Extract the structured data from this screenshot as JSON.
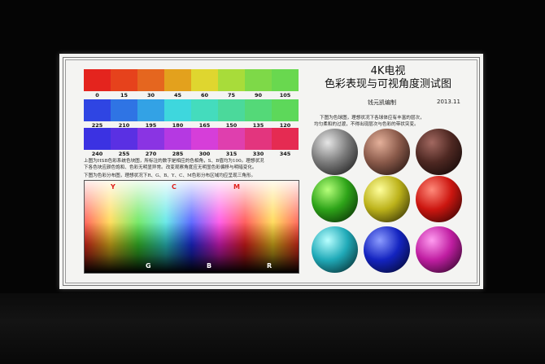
{
  "chart": {
    "title_line1": "4K电视",
    "title_line2": "色彩表现与可视角度测试图",
    "author": "钱元凯编制",
    "date": "2013.11"
  },
  "hue_rows": [
    {
      "hues": [
        "0",
        "15",
        "30",
        "45",
        "60",
        "75",
        "90",
        "105"
      ],
      "colors": [
        "#e4241e",
        "#e6421c",
        "#e5661f",
        "#e3a11d",
        "#dfd62f",
        "#a8dc3a",
        "#7ed948",
        "#69d84f"
      ]
    },
    {
      "hues": [
        "225",
        "210",
        "195",
        "180",
        "165",
        "150",
        "135",
        "120"
      ],
      "colors": [
        "#2f45e3",
        "#2f74e4",
        "#33a2e5",
        "#3ed7dd",
        "#44dcbd",
        "#4bd99b",
        "#54d978",
        "#5dd85a"
      ]
    },
    {
      "hues": [
        "240",
        "255",
        "270",
        "285",
        "300",
        "315",
        "330",
        "345"
      ],
      "colors": [
        "#3b32e2",
        "#5a30e3",
        "#8a34e3",
        "#b539e2",
        "#d63ed9",
        "#df3fae",
        "#e3357e",
        "#e52b52"
      ]
    }
  ],
  "texts": {
    "hue_note_line1": "上图为HSB色彩系统色块图，所标注的数字是相应的色相角，S、B值均为100。理想状况",
    "hue_note_line2": "下各色块应颜色饱和、色彩无明显异常。改变观察角度应无明显色彩偏移与明暗变化。",
    "dist_note": "下图为色彩分布图，理想状况下R、G、B、Y、C、M色彩分布区域均应呈现三角形。",
    "sphere_note_line1": "下图为色球图，理想状况下各球体应有丰富的层次，",
    "sphere_note_line2": "均匀柔和的过渡，不得出现层次与色彩的带状突变。"
  },
  "distribution_labels": {
    "top": [
      "Y",
      "C",
      "M"
    ],
    "bottom": [
      "G",
      "B",
      "R"
    ]
  },
  "spheres": [
    {
      "name": "gray",
      "light": "#e6e6e6",
      "mid": "#7c7c7c",
      "dark": "#0c0c0c"
    },
    {
      "name": "tan",
      "light": "#e4b09a",
      "mid": "#8a5a4a",
      "dark": "#120806"
    },
    {
      "name": "brown",
      "light": "#a26860",
      "mid": "#4e2822",
      "dark": "#070202"
    },
    {
      "name": "green",
      "light": "#b6ff7a",
      "mid": "#2ea419",
      "dark": "#031802"
    },
    {
      "name": "yellow",
      "light": "#ffff9c",
      "mid": "#bcb21a",
      "dark": "#1a1802"
    },
    {
      "name": "red",
      "light": "#ff8a7a",
      "mid": "#cc1610",
      "dark": "#1a0202"
    },
    {
      "name": "cyan",
      "light": "#b8ffff",
      "mid": "#20aab8",
      "dark": "#021618"
    },
    {
      "name": "blue",
      "light": "#8c9cff",
      "mid": "#1424c0",
      "dark": "#020418"
    },
    {
      "name": "magenta",
      "light": "#ff9cf0",
      "mid": "#c01ea2",
      "dark": "#180214"
    }
  ],
  "colors": {
    "background": "#050505",
    "screen": "#f4f4f2",
    "label_red": "#e0201c"
  }
}
